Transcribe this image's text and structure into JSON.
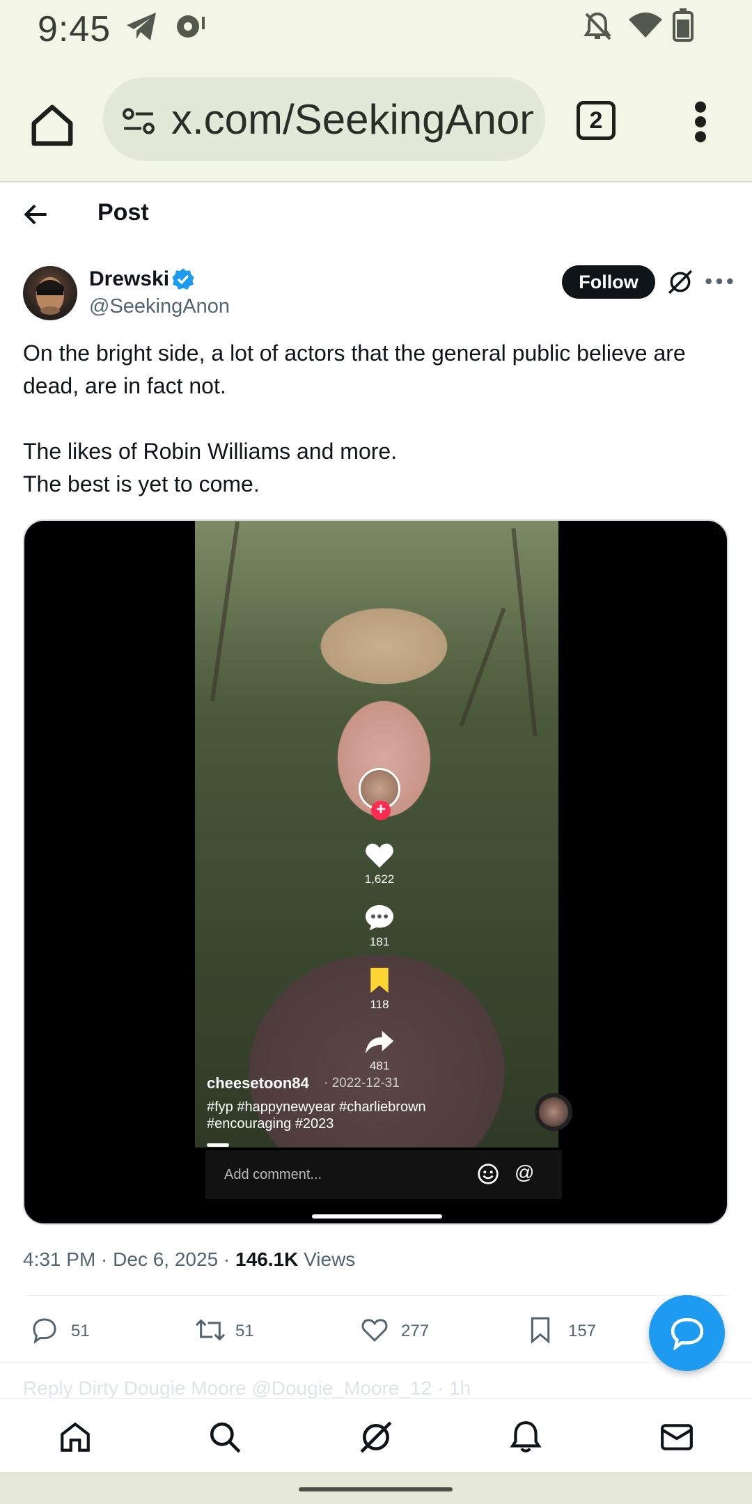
{
  "status_bar": {
    "time": "9:45"
  },
  "browser": {
    "url": "x.com/SeekingAnon",
    "tab_count": "2"
  },
  "header": {
    "title": "Post"
  },
  "author": {
    "name": "Drewski",
    "handle": "@SeekingAnon",
    "follow_label": "Follow"
  },
  "post": {
    "text": "On the bright side, a lot of actors that the general public believe are dead, are in fact not.\n\nThe likes of Robin Williams and more.\nThe best is yet to come."
  },
  "video": {
    "likes": "1,622",
    "comments": "181",
    "saves": "118",
    "shares": "481",
    "username": "cheesetoon84",
    "date": "· 2022-12-31",
    "tags": "#fyp #happynewyear #charliebrown #encouraging #2023",
    "comment_placeholder": "Add comment...",
    "at_symbol": "@"
  },
  "meta": {
    "time_date": "4:31 PM · Dec 6, 2025 · ",
    "views_count": "146.1K",
    "views_label": " Views"
  },
  "actions": {
    "replies": "51",
    "reposts": "51",
    "likes": "277",
    "bookmarks": "157"
  },
  "ghost_reply": "Reply   Dirty Dougie Moore   @Dougie_Moore_12 · 1h",
  "colors": {
    "accent": "#1d9bf0",
    "text": "#0f1419",
    "muted": "#536471",
    "chrome_bg": "#f3f6e6"
  }
}
